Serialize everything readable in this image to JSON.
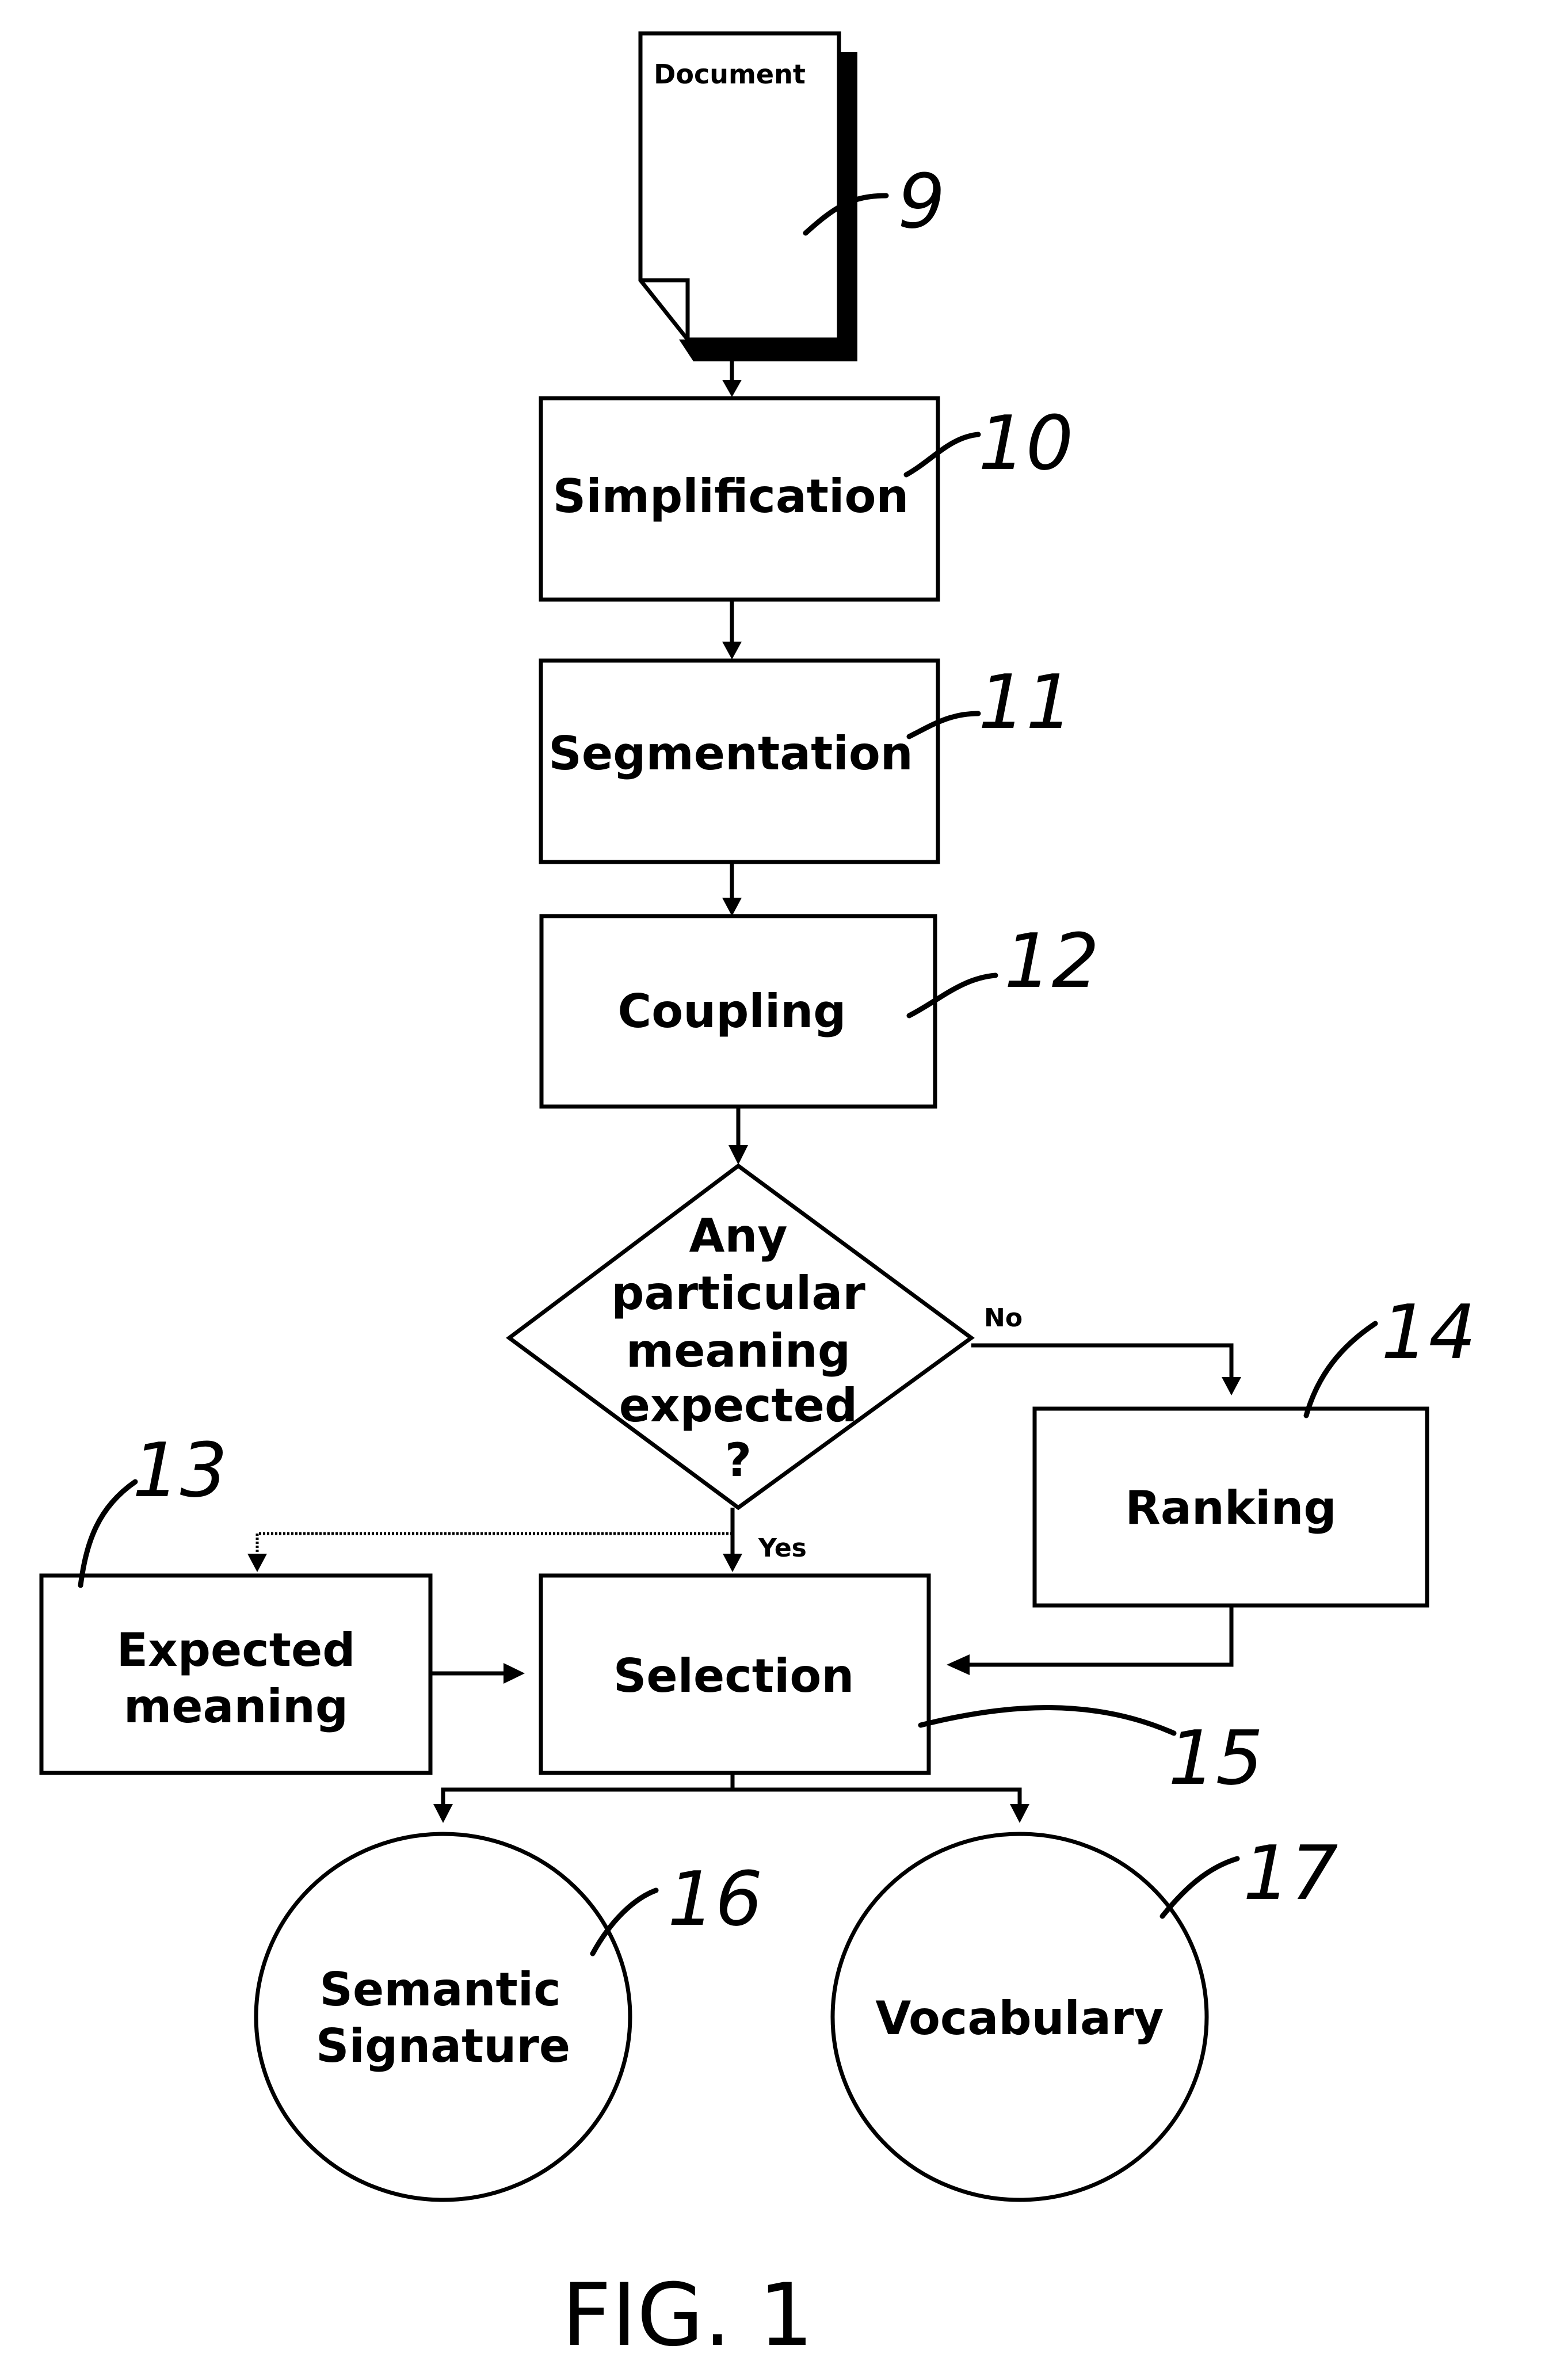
{
  "figure": {
    "caption": "FIG. 1"
  },
  "nodes": {
    "document": {
      "label": "Document",
      "ref": "9",
      "shape": "document-icon"
    },
    "simplification": {
      "label": "Simplification",
      "ref": "10"
    },
    "segmentation": {
      "label": "Segmentation",
      "ref": "11"
    },
    "coupling": {
      "label": "Coupling",
      "ref": "12"
    },
    "decision": {
      "lines": [
        "Any",
        "particular",
        "meaning",
        "expected",
        "?"
      ]
    },
    "expected_meaning": {
      "lines": [
        "Expected",
        "meaning"
      ],
      "ref": "13"
    },
    "ranking": {
      "label": "Ranking",
      "ref": "14"
    },
    "selection": {
      "label": "Selection",
      "ref": "15"
    },
    "semantic_signature": {
      "lines": [
        "Semantic",
        "Signature"
      ],
      "ref": "16"
    },
    "vocabulary": {
      "label": "Vocabulary",
      "ref": "17"
    }
  },
  "edges": {
    "no_label": "No",
    "yes_label": "Yes"
  }
}
